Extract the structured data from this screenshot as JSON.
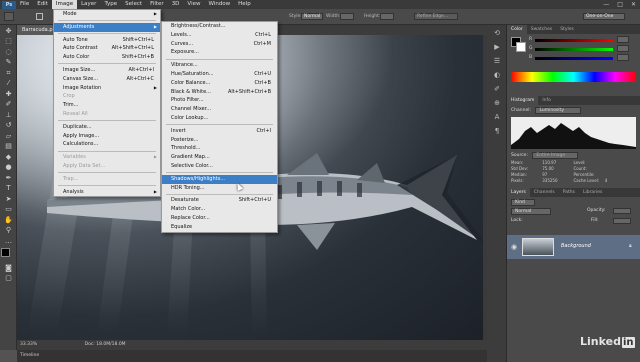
{
  "menubar": {
    "logo": "Ps",
    "items": [
      "File",
      "Edit",
      "Image",
      "Layer",
      "Type",
      "Select",
      "Filter",
      "3D",
      "View",
      "Window",
      "Help"
    ],
    "window_controls": [
      "—",
      "□",
      "✕"
    ]
  },
  "options_bar": {
    "style_label": "Style:",
    "style_value": "Normal",
    "width_label": "Width:",
    "height_label": "Height:",
    "refine_edge": "Refine Edge...",
    "workspace": "One-on-One"
  },
  "document": {
    "tab_title": "Barracuda.p..."
  },
  "status": {
    "zoom": "33.33%",
    "doc_info": "Doc: 18.0M/18.0M"
  },
  "timeline": {
    "label": "Timeline"
  },
  "image_menu": {
    "items": [
      {
        "label": "Mode",
        "shortcut": "",
        "submenu": true,
        "disabled": false
      },
      {
        "sep": true
      },
      {
        "label": "Adjustments",
        "shortcut": "",
        "submenu": true,
        "disabled": false,
        "highlighted": true
      },
      {
        "sep": true
      },
      {
        "label": "Auto Tone",
        "shortcut": "Shift+Ctrl+L",
        "disabled": false
      },
      {
        "label": "Auto Contrast",
        "shortcut": "Alt+Shift+Ctrl+L",
        "disabled": false
      },
      {
        "label": "Auto Color",
        "shortcut": "Shift+Ctrl+B",
        "disabled": false
      },
      {
        "sep": true
      },
      {
        "label": "Image Size...",
        "shortcut": "Alt+Ctrl+I",
        "disabled": false
      },
      {
        "label": "Canvas Size...",
        "shortcut": "Alt+Ctrl+C",
        "disabled": false
      },
      {
        "label": "Image Rotation",
        "shortcut": "",
        "submenu": true,
        "disabled": false
      },
      {
        "label": "Crop",
        "shortcut": "",
        "disabled": true
      },
      {
        "label": "Trim...",
        "shortcut": "",
        "disabled": false
      },
      {
        "label": "Reveal All",
        "shortcut": "",
        "disabled": true
      },
      {
        "sep": true
      },
      {
        "label": "Duplicate...",
        "shortcut": "",
        "disabled": false
      },
      {
        "label": "Apply Image...",
        "shortcut": "",
        "disabled": false
      },
      {
        "label": "Calculations...",
        "shortcut": "",
        "disabled": false
      },
      {
        "sep": true
      },
      {
        "label": "Variables",
        "shortcut": "",
        "submenu": true,
        "disabled": true
      },
      {
        "label": "Apply Data Set...",
        "shortcut": "",
        "disabled": true
      },
      {
        "sep": true
      },
      {
        "label": "Trap...",
        "shortcut": "",
        "disabled": true
      },
      {
        "sep": true
      },
      {
        "label": "Analysis",
        "shortcut": "",
        "submenu": true,
        "disabled": false
      }
    ]
  },
  "adjustments_menu": {
    "items": [
      {
        "label": "Brightness/Contrast...",
        "shortcut": ""
      },
      {
        "label": "Levels...",
        "shortcut": "Ctrl+L"
      },
      {
        "label": "Curves...",
        "shortcut": "Ctrl+M"
      },
      {
        "label": "Exposure...",
        "shortcut": ""
      },
      {
        "sep": true
      },
      {
        "label": "Vibrance...",
        "shortcut": ""
      },
      {
        "label": "Hue/Saturation...",
        "shortcut": "Ctrl+U"
      },
      {
        "label": "Color Balance...",
        "shortcut": "Ctrl+B"
      },
      {
        "label": "Black & White...",
        "shortcut": "Alt+Shift+Ctrl+B"
      },
      {
        "label": "Photo Filter...",
        "shortcut": ""
      },
      {
        "label": "Channel Mixer...",
        "shortcut": ""
      },
      {
        "label": "Color Lookup...",
        "shortcut": ""
      },
      {
        "sep": true
      },
      {
        "label": "Invert",
        "shortcut": "Ctrl+I"
      },
      {
        "label": "Posterize...",
        "shortcut": ""
      },
      {
        "label": "Threshold...",
        "shortcut": ""
      },
      {
        "label": "Gradient Map...",
        "shortcut": ""
      },
      {
        "label": "Selective Color...",
        "shortcut": ""
      },
      {
        "sep": true
      },
      {
        "label": "Shadows/Highlights...",
        "shortcut": "",
        "highlighted": true
      },
      {
        "label": "HDR Toning...",
        "shortcut": ""
      },
      {
        "sep": true
      },
      {
        "label": "Desaturate",
        "shortcut": "Shift+Ctrl+U"
      },
      {
        "label": "Match Color...",
        "shortcut": ""
      },
      {
        "label": "Replace Color...",
        "shortcut": ""
      },
      {
        "label": "Equalize",
        "shortcut": ""
      }
    ]
  },
  "color_panel": {
    "tabs": [
      "Color",
      "Swatches",
      "Styles"
    ],
    "sliders": [
      "R",
      "G",
      "B"
    ]
  },
  "histogram_panel": {
    "tabs": [
      "Histogram",
      "Info"
    ],
    "channel_label": "Channel:",
    "channel_value": "Luminosity",
    "source_label": "Source:",
    "source_value": "Entire Image",
    "stats": [
      [
        "Mean:",
        "110.97",
        "Level:",
        ""
      ],
      [
        "Std Dev:",
        "75.00",
        "Count:",
        ""
      ],
      [
        "Median:",
        "97",
        "Percentile:",
        ""
      ],
      [
        "Pixels:",
        "335250",
        "Cache Level:",
        "4"
      ]
    ]
  },
  "layers_panel": {
    "tabs": [
      "Layers",
      "Channels",
      "Paths",
      "Libraries"
    ],
    "kind_label": "Kind",
    "blend_mode": "Normal",
    "opacity_label": "Opacity:",
    "lock_label": "Lock:",
    "fill_label": "Fill:",
    "layer_name": "Background"
  },
  "watermark": {
    "text": "Linked",
    "suffix": "in"
  },
  "colors": {
    "highlight": "#3d7fc7",
    "menu_bg": "#e8e8e8",
    "panel_bg": "#4a4a4a"
  }
}
